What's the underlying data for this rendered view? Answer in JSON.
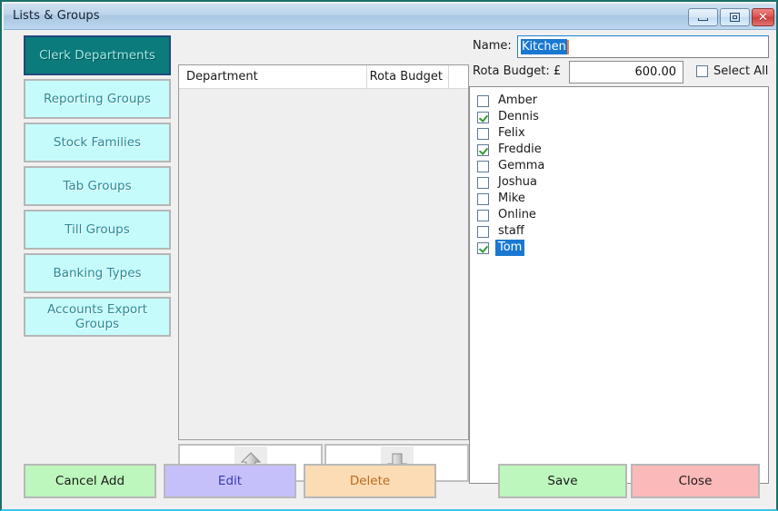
{
  "window": {
    "title": "Lists & Groups",
    "controls": {
      "minimize": "minimize-icon",
      "maximize": "maximize-icon",
      "close": "close-icon",
      "close_glyph": "✕"
    },
    "border_color": "#1b6f6a",
    "accent_color": "#0b7b7b"
  },
  "sidebar": {
    "items": [
      {
        "label": "Clerk Departments",
        "active": true
      },
      {
        "label": "Reporting Groups",
        "active": false
      },
      {
        "label": "Stock Families",
        "active": false
      },
      {
        "label": "Tab Groups",
        "active": false
      },
      {
        "label": "Till Groups",
        "active": false
      },
      {
        "label": "Banking Types",
        "active": false
      },
      {
        "label": "Accounts Export Groups",
        "active": false
      }
    ]
  },
  "list_panel": {
    "columns": [
      "Department",
      "Rota Budget"
    ],
    "rows": [],
    "move_up_icon": "arrow-up-icon",
    "move_down_icon": "arrow-down-icon"
  },
  "details": {
    "name_label": "Name:",
    "name_value": "Kitchen",
    "budget_label": "Rota Budget: £",
    "budget_value": "600.00",
    "select_all_label": "Select All",
    "select_all_checked": false,
    "members": [
      {
        "label": "Amber",
        "checked": false,
        "selected": false
      },
      {
        "label": "Dennis",
        "checked": true,
        "selected": false
      },
      {
        "label": "Felix",
        "checked": false,
        "selected": false
      },
      {
        "label": "Freddie",
        "checked": true,
        "selected": false
      },
      {
        "label": "Gemma",
        "checked": false,
        "selected": false
      },
      {
        "label": "Joshua",
        "checked": false,
        "selected": false
      },
      {
        "label": "Mike",
        "checked": false,
        "selected": false
      },
      {
        "label": "Online",
        "checked": false,
        "selected": false
      },
      {
        "label": "staff",
        "checked": false,
        "selected": false
      },
      {
        "label": "Tom",
        "checked": true,
        "selected": true
      }
    ]
  },
  "actions": {
    "cancel_add": "Cancel Add",
    "edit": "Edit",
    "delete": "Delete",
    "save": "Save",
    "close": "Close"
  }
}
